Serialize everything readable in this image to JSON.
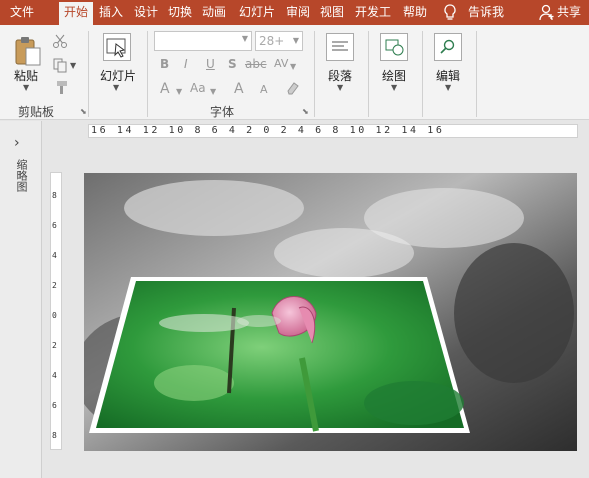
{
  "tabs": [
    {
      "label": "文件",
      "active": false
    },
    {
      "label": "开始",
      "active": true
    },
    {
      "label": "插入",
      "active": false
    },
    {
      "label": "设计",
      "active": false
    },
    {
      "label": "切换",
      "active": false
    },
    {
      "label": "动画",
      "active": false
    },
    {
      "label": "幻灯片",
      "active": false
    },
    {
      "label": "审阅",
      "active": false
    },
    {
      "label": "视图",
      "active": false
    },
    {
      "label": "开发工",
      "active": false
    },
    {
      "label": "帮助",
      "active": false
    }
  ],
  "tell_me": "告诉我",
  "share": "共享",
  "clipboard": {
    "paste_label": "粘贴",
    "group_label": "剪贴板"
  },
  "slides": {
    "label": "幻灯片"
  },
  "font": {
    "name_value": "",
    "size_value": "28+",
    "group_label": "字体",
    "bold": "B",
    "italic": "I",
    "underline": "U",
    "shadow": "S",
    "strike": "abc",
    "char_spacing": "AV",
    "case": "Aa",
    "grow": "A",
    "shrink": "A",
    "font_color": "A"
  },
  "paragraph": {
    "label": "段落"
  },
  "drawing": {
    "label": "绘图"
  },
  "editing": {
    "label": "编辑"
  },
  "thumbnail_pane": {
    "label": "缩略图",
    "collapse_glyph": "›"
  },
  "hruler": {
    "text": "16 14 12 10 8 6 4 2 0 2 4 6 8 10 12 14 16"
  },
  "vruler": {
    "labels": [
      "8",
      "6",
      "4",
      "2",
      "0",
      "2",
      "4",
      "6",
      "8"
    ]
  },
  "colors": {
    "accent": "#b7472a",
    "ribbon": "#f3f3f3",
    "workspace": "#e6e6e6"
  }
}
